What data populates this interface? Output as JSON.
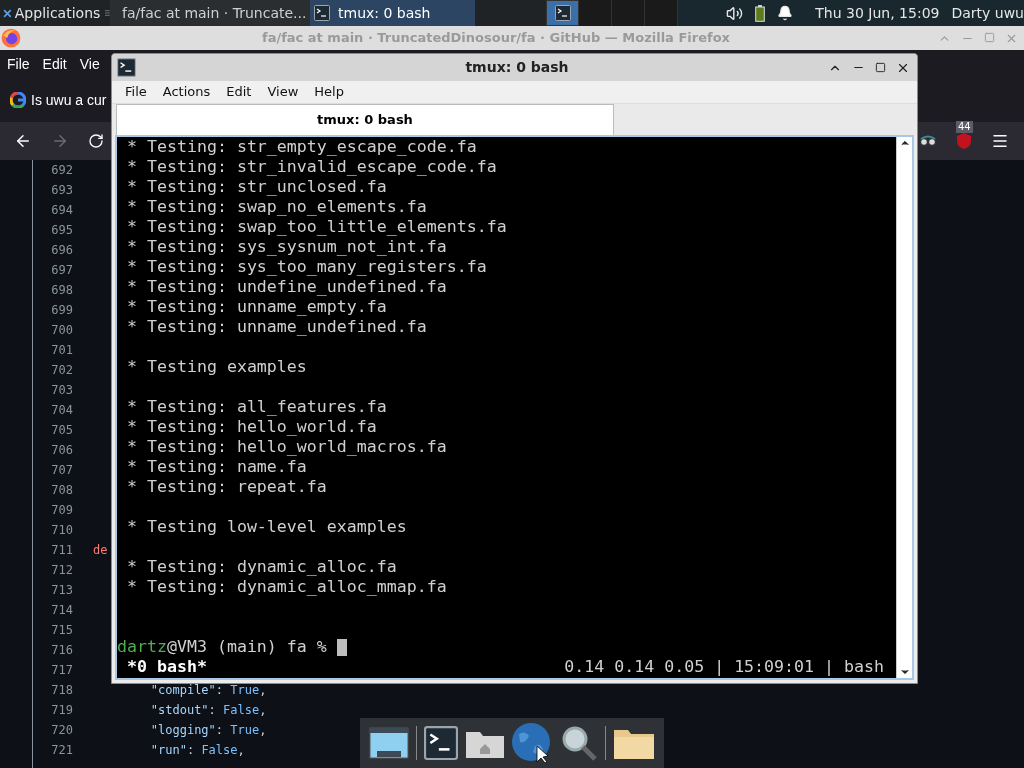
{
  "top_panel": {
    "applications": "Applications",
    "tasks": [
      {
        "kind": "browser",
        "title": "fa/fac at main · Truncate...",
        "selected": false
      },
      {
        "kind": "terminal",
        "title": "tmux: 0 bash",
        "selected": true
      }
    ],
    "workspaces": [
      {
        "selected": true
      },
      {
        "selected": false
      },
      {
        "selected": false
      },
      {
        "selected": false
      }
    ],
    "clock": "Thu 30 Jun, 15:09",
    "user": "Darty uwu"
  },
  "browser": {
    "title": "fa/fac at main · TruncatedDinosour/fa · GitHub — Mozilla Firefox",
    "menu": [
      "File",
      "Edit",
      "Vie"
    ],
    "tab": "Is uwu a cur",
    "forward_disabled": true,
    "badge": "44",
    "code_lines": [
      {
        "number": "692"
      },
      {
        "number": "693"
      },
      {
        "number": "694"
      },
      {
        "number": "695"
      },
      {
        "number": "696"
      },
      {
        "number": "697"
      },
      {
        "number": "698"
      },
      {
        "number": "699"
      },
      {
        "number": "700"
      },
      {
        "number": "701"
      },
      {
        "number": "702"
      },
      {
        "number": "703"
      },
      {
        "number": "704"
      },
      {
        "number": "705"
      },
      {
        "number": "706"
      },
      {
        "number": "707"
      },
      {
        "number": "708"
      },
      {
        "number": "709"
      },
      {
        "number": "710"
      },
      {
        "number": "711",
        "tokens": [
          {
            "text": "de",
            "kind": "keyword"
          }
        ]
      },
      {
        "number": "712"
      },
      {
        "number": "713"
      },
      {
        "number": "714"
      },
      {
        "number": "715"
      },
      {
        "number": "716"
      },
      {
        "number": "717"
      },
      {
        "number": "718",
        "tokens": [
          {
            "text": "        \"compile\"",
            "kind": "string"
          },
          {
            "text": ": ",
            "kind": "plain"
          },
          {
            "text": "True",
            "kind": "constant"
          },
          {
            "text": ",",
            "kind": "plain"
          }
        ]
      },
      {
        "number": "719",
        "tokens": [
          {
            "text": "        \"stdout\"",
            "kind": "string"
          },
          {
            "text": ": ",
            "kind": "plain"
          },
          {
            "text": "False",
            "kind": "constant"
          },
          {
            "text": ",",
            "kind": "plain"
          }
        ]
      },
      {
        "number": "720",
        "tokens": [
          {
            "text": "        \"logging\"",
            "kind": "string"
          },
          {
            "text": ": ",
            "kind": "plain"
          },
          {
            "text": "True",
            "kind": "constant"
          },
          {
            "text": ",",
            "kind": "plain"
          }
        ]
      },
      {
        "number": "721",
        "tokens": [
          {
            "text": "        \"run\"",
            "kind": "string"
          },
          {
            "text": ": ",
            "kind": "plain"
          },
          {
            "text": "False",
            "kind": "constant"
          },
          {
            "text": ",",
            "kind": "plain"
          }
        ]
      }
    ]
  },
  "terminal": {
    "title": "tmux: 0 bash",
    "menu": [
      "File",
      "Actions",
      "Edit",
      "View",
      "Help"
    ],
    "tabs": [
      {
        "label": "tmux: 0 bash",
        "selected": true
      }
    ],
    "lines": [
      {
        "kind": "output",
        "text": "* Testing: str_empty_escape_code.fa"
      },
      {
        "kind": "output",
        "text": "* Testing: str_invalid_escape_code.fa"
      },
      {
        "kind": "output",
        "text": "* Testing: str_unclosed.fa"
      },
      {
        "kind": "output",
        "text": "* Testing: swap_no_elements.fa"
      },
      {
        "kind": "output",
        "text": "* Testing: swap_too_little_elements.fa"
      },
      {
        "kind": "output",
        "text": "* Testing: sys_sysnum_not_int.fa"
      },
      {
        "kind": "output",
        "text": "* Testing: sys_too_many_registers.fa"
      },
      {
        "kind": "output",
        "text": "* Testing: undefine_undefined.fa"
      },
      {
        "kind": "output",
        "text": "* Testing: unname_empty.fa"
      },
      {
        "kind": "output",
        "text": "* Testing: unname_undefined.fa"
      },
      {
        "kind": "blank"
      },
      {
        "kind": "output",
        "text": "* Testing examples"
      },
      {
        "kind": "blank"
      },
      {
        "kind": "output",
        "text": "* Testing: all_features.fa"
      },
      {
        "kind": "output",
        "text": "* Testing: hello_world.fa"
      },
      {
        "kind": "output",
        "text": "* Testing: hello_world_macros.fa"
      },
      {
        "kind": "output",
        "text": "* Testing: name.fa"
      },
      {
        "kind": "output",
        "text": "* Testing: repeat.fa"
      },
      {
        "kind": "blank"
      },
      {
        "kind": "output",
        "text": "* Testing low-level examples"
      },
      {
        "kind": "blank"
      },
      {
        "kind": "output",
        "text": "* Testing: dynamic_alloc.fa"
      },
      {
        "kind": "output",
        "text": "* Testing: dynamic_alloc_mmap.fa"
      },
      {
        "kind": "blank"
      },
      {
        "kind": "blank"
      },
      {
        "kind": "prompt",
        "user": "dartz",
        "text": "@VM3 (main) fa %"
      }
    ],
    "status_left": "*0 bash*",
    "status_right": "0.14 0.14 0.05 | 15:09:01 | bash"
  }
}
